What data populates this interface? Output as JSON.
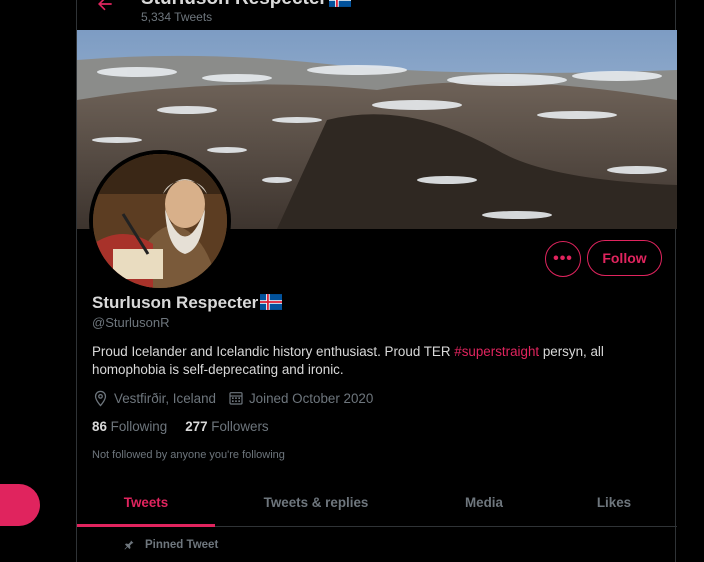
{
  "colors": {
    "accent": "#e0245e",
    "background": "#000000",
    "text": "#d9d9d9",
    "muted": "#6e767d"
  },
  "header": {
    "title": "Sturluson Respecter",
    "tweet_count": "5,334 Tweets"
  },
  "profile": {
    "name": "Sturluson Respecter",
    "handle": "@SturlusonR",
    "bio_prefix": "Proud Icelander and Icelandic history enthusiast.  Proud TER ",
    "bio_hashtag": "#superstraight",
    "bio_suffix": " persyn, all homophobia is self-deprecating and ironic.",
    "location": "Vestfirðir, Iceland",
    "joined": "Joined October 2020",
    "following_count": "86",
    "following_label": "Following",
    "followers_count": "277",
    "followers_label": "Followers",
    "followed_note": "Not followed by anyone you're following"
  },
  "actions": {
    "more_label": "•••",
    "follow_label": "Follow"
  },
  "tabs": [
    {
      "label": "Tweets",
      "active": true
    },
    {
      "label": "Tweets & replies",
      "active": false
    },
    {
      "label": "Media",
      "active": false
    },
    {
      "label": "Likes",
      "active": false
    }
  ],
  "pinned_label": "Pinned Tweet",
  "icons": [
    "back-arrow-icon",
    "iceland-flag-icon",
    "location-pin-icon",
    "calendar-icon",
    "pin-icon"
  ]
}
